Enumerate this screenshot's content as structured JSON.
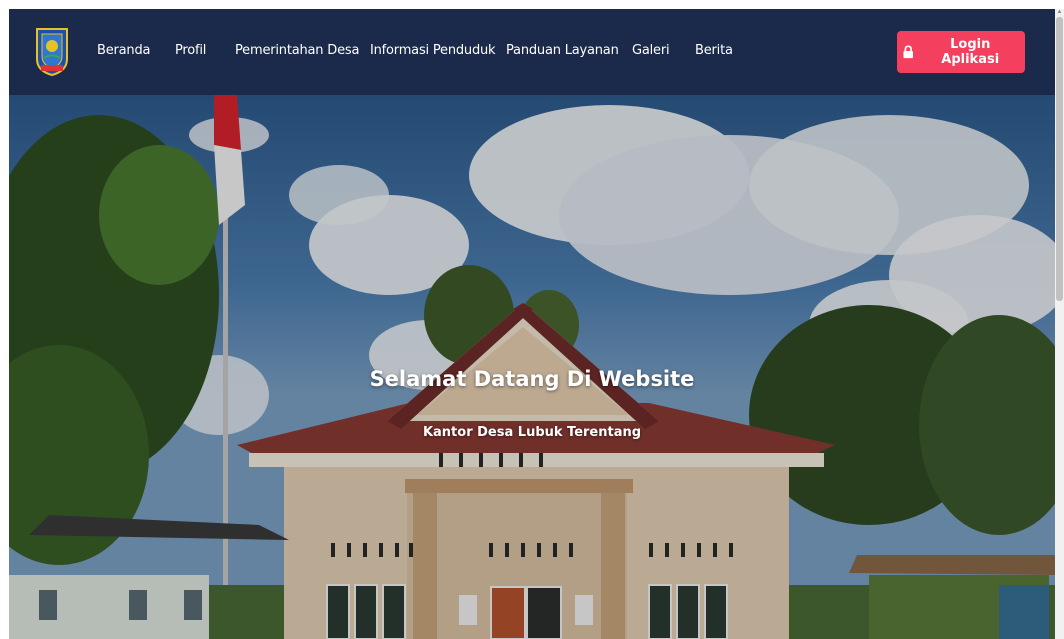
{
  "nav": {
    "items": [
      {
        "label": "Beranda"
      },
      {
        "label": "Profil"
      },
      {
        "label": "Pemerintahan Desa"
      },
      {
        "label": "Informasi Penduduk"
      },
      {
        "label": "Panduan Layanan"
      },
      {
        "label": "Galeri"
      },
      {
        "label": "Berita"
      }
    ],
    "login_label": "Login Aplikasi",
    "logo_icon": "village-emblem-logo"
  },
  "hero": {
    "title": "Selamat Datang Di Website",
    "subtitle": "Kantor Desa Lubuk Terentang",
    "image": "village-office-building-photo"
  },
  "colors": {
    "navbar": "#1b2a4a",
    "accent": "#f43f5e",
    "text": "#ffffff"
  }
}
